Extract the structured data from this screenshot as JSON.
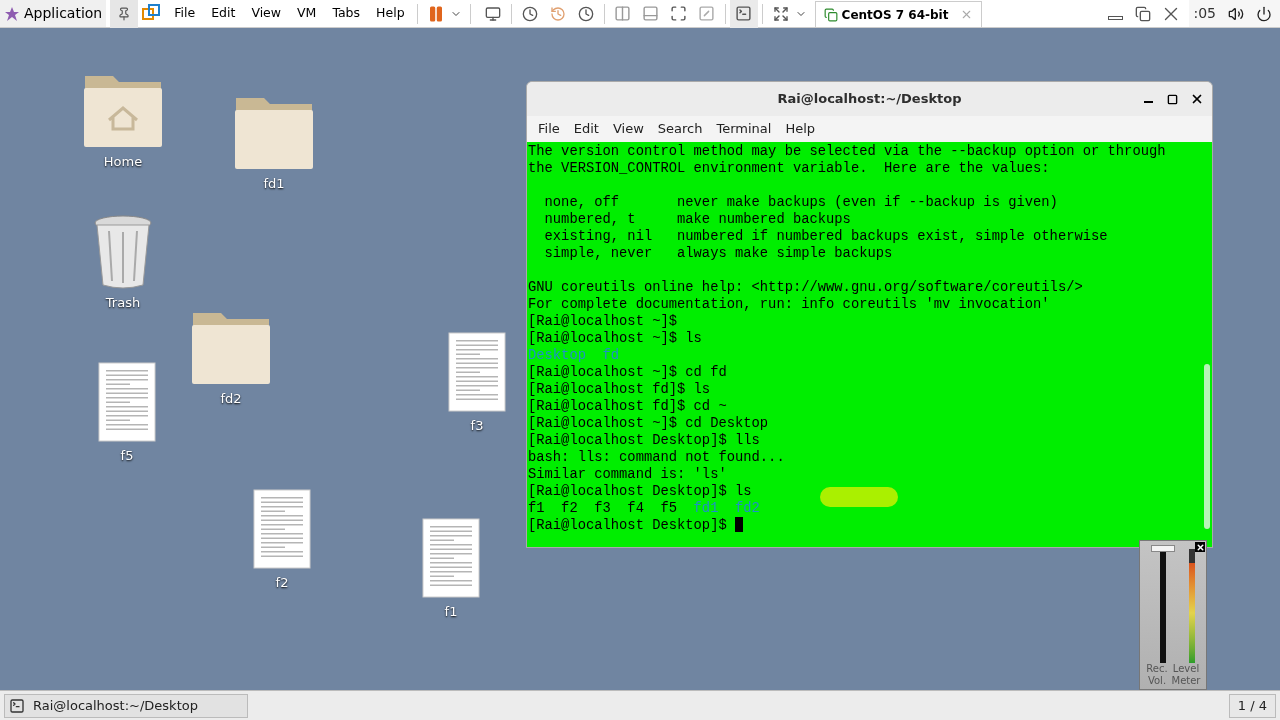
{
  "top_bar": {
    "app_menu": "Application",
    "menus": [
      "File",
      "Edit",
      "View",
      "VM",
      "Tabs",
      "Help"
    ],
    "vm_tab": {
      "label": "CentOS 7 64-bit",
      "selected": true
    },
    "clock": ":05"
  },
  "desktop_icons": [
    {
      "label": "Home",
      "kind": "home"
    },
    {
      "label": "fd1",
      "kind": "folder"
    },
    {
      "label": "Trash",
      "kind": "trash"
    },
    {
      "label": "fd2",
      "kind": "folder"
    },
    {
      "label": "f5",
      "kind": "document"
    },
    {
      "label": "f3",
      "kind": "document"
    },
    {
      "label": "f2",
      "kind": "document"
    },
    {
      "label": "f1",
      "kind": "document"
    }
  ],
  "terminal": {
    "title": "Rai@localhost:~/Desktop",
    "menus": [
      "File",
      "Edit",
      "View",
      "Search",
      "Terminal",
      "Help"
    ],
    "lines": [
      {
        "kind": "text",
        "segments": [
          {
            "text": "The version control method may be selected via the --backup option or through",
            "kind": "plain"
          }
        ]
      },
      {
        "kind": "text",
        "segments": [
          {
            "text": "the VERSION_CONTROL environment variable.  Here are the values:",
            "kind": "plain"
          }
        ]
      },
      {
        "kind": "blank"
      },
      {
        "kind": "text",
        "segments": [
          {
            "text": "  none, off       never make backups (even if --backup is given)",
            "kind": "plain"
          }
        ]
      },
      {
        "kind": "text",
        "segments": [
          {
            "text": "  numbered, t     make numbered backups",
            "kind": "plain"
          }
        ]
      },
      {
        "kind": "text",
        "segments": [
          {
            "text": "  existing, nil   numbered if numbered backups exist, simple otherwise",
            "kind": "plain"
          }
        ]
      },
      {
        "kind": "text",
        "segments": [
          {
            "text": "  simple, never   always make simple backups",
            "kind": "plain"
          }
        ]
      },
      {
        "kind": "blank"
      },
      {
        "kind": "text",
        "segments": [
          {
            "text": "GNU coreutils online help: <http://www.gnu.org/software/coreutils/>",
            "kind": "plain"
          }
        ]
      },
      {
        "kind": "text",
        "segments": [
          {
            "text": "For complete documentation, run: info coreutils 'mv invocation'",
            "kind": "plain"
          }
        ]
      },
      {
        "kind": "text",
        "segments": [
          {
            "text": "[Rai@localhost ~]$",
            "kind": "plain"
          }
        ]
      },
      {
        "kind": "text",
        "segments": [
          {
            "text": "[Rai@localhost ~]$ ls",
            "kind": "plain"
          }
        ]
      },
      {
        "kind": "text",
        "segments": [
          {
            "text": "Desktop  fd",
            "kind": "dir"
          }
        ]
      },
      {
        "kind": "text",
        "segments": [
          {
            "text": "[Rai@localhost ~]$ cd fd",
            "kind": "plain"
          }
        ]
      },
      {
        "kind": "text",
        "segments": [
          {
            "text": "[Rai@localhost fd]$ ls",
            "kind": "plain"
          }
        ]
      },
      {
        "kind": "text",
        "segments": [
          {
            "text": "[Rai@localhost fd]$ cd ~",
            "kind": "plain"
          }
        ]
      },
      {
        "kind": "text",
        "segments": [
          {
            "text": "[Rai@localhost ~]$ cd Desktop",
            "kind": "plain"
          }
        ]
      },
      {
        "kind": "text",
        "segments": [
          {
            "text": "[Rai@localhost Desktop]$ lls",
            "kind": "plain"
          }
        ]
      },
      {
        "kind": "text",
        "segments": [
          {
            "text": "bash: lls: command not found...",
            "kind": "plain"
          }
        ]
      },
      {
        "kind": "text",
        "segments": [
          {
            "text": "Similar command is: 'ls'",
            "kind": "plain"
          }
        ]
      },
      {
        "kind": "text",
        "segments": [
          {
            "text": "[Rai@localhost Desktop]$ ls",
            "kind": "plain"
          }
        ]
      },
      {
        "kind": "text",
        "segments": [
          {
            "text": "f1  f2  f3  f4  f5  ",
            "kind": "plain"
          },
          {
            "text": "fd1  fd2",
            "kind": "dir"
          }
        ]
      },
      {
        "kind": "text",
        "segments": [
          {
            "text": "[Rai@localhost Desktop]$",
            "kind": "plain"
          },
          {
            "kind": "cursor"
          }
        ]
      }
    ]
  },
  "volume_widget": {
    "rec_label": "Rec. Vol.",
    "meter_label": "Level Meter",
    "rec": {
      "level": 1
    },
    "meter": {
      "level": 0.88
    }
  },
  "taskbar": {
    "window": "Rai@localhost:~/Desktop",
    "workspace": "1 / 4"
  }
}
